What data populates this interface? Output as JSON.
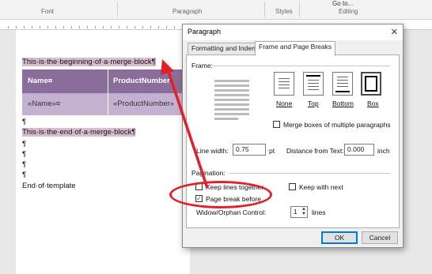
{
  "ribbon": {
    "groups": [
      "Font",
      "Paragraph",
      "Styles",
      "Editing"
    ],
    "go_to": "Go to..."
  },
  "doc": {
    "merge_begin": "This·is·the·beginning·of·a·merge·block¶",
    "table_headers": [
      "Name¤",
      "ProductNumber"
    ],
    "table_cells": [
      "«Name»¤",
      "«ProductNumber»"
    ],
    "pilcrow": "¶",
    "merge_end": "This·is·the·end·of·a·merge·block¶",
    "end_template": "End·of·template"
  },
  "dialog": {
    "title": "Paragraph",
    "close": "✕",
    "tabs": [
      "Formatting and Indents",
      "Frame and Page Breaks"
    ],
    "frame_label": "Frame:",
    "frame_options": [
      "None",
      "Top",
      "Bottom",
      "Box"
    ],
    "merge_boxes": "Merge boxes of multiple paragraphs",
    "line_width_label": "Line width:",
    "line_width_value": "0.75",
    "line_width_unit": "pt",
    "distance_label": "Distance from Text:",
    "distance_value": "0.000",
    "distance_unit": "inch",
    "pagination_label": "Pagination:",
    "keep_lines": "Keep lines together",
    "keep_next": "Keep with next",
    "page_break": "Page break before",
    "widow_label": "Widow/Orphan Control:",
    "widow_value": "1",
    "widow_unit": "lines",
    "ok": "OK",
    "cancel": "Cancel"
  },
  "annotation_color": "#e0202a"
}
